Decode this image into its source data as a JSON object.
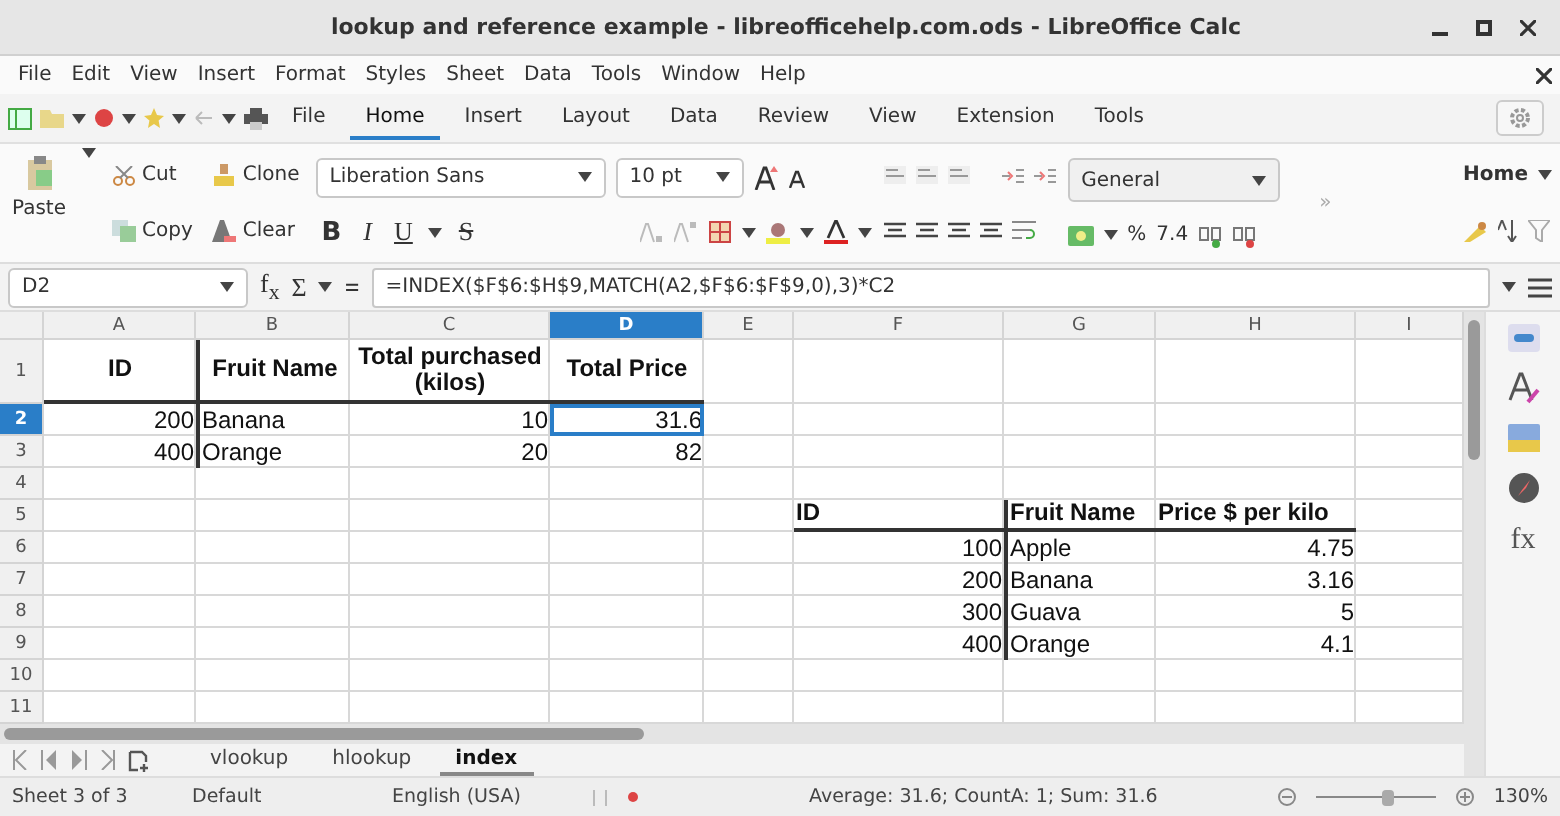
{
  "window": {
    "title": "lookup and reference example - libreofficehelp.com.ods - LibreOffice Calc"
  },
  "menu": [
    "File",
    "Edit",
    "View",
    "Insert",
    "Format",
    "Styles",
    "Sheet",
    "Data",
    "Tools",
    "Window",
    "Help"
  ],
  "tabs": [
    {
      "label": "File",
      "selected": false
    },
    {
      "label": "Home",
      "selected": true
    },
    {
      "label": "Insert",
      "selected": false
    },
    {
      "label": "Layout",
      "selected": false
    },
    {
      "label": "Data",
      "selected": false
    },
    {
      "label": "Review",
      "selected": false
    },
    {
      "label": "View",
      "selected": false
    },
    {
      "label": "Extension",
      "selected": false
    },
    {
      "label": "Tools",
      "selected": false
    }
  ],
  "ribbon": {
    "paste": "Paste",
    "cut": "Cut",
    "copy": "Copy",
    "clone": "Clone",
    "clear": "Clear",
    "font_name": "Liberation Sans",
    "font_size": "10 pt",
    "bold": "B",
    "italic": "I",
    "underline": "U",
    "strike": "S",
    "number_format": "General",
    "percent": "%",
    "decimal": "7.4",
    "more": "»",
    "style_menu": "Home"
  },
  "formula_bar": {
    "name_box": "D2",
    "function": "f$_{x}$",
    "sum": "Σ",
    "equals": "=",
    "formula": "=INDEX($F$6:$H$9,MATCH(A2,$F$6:$F$9,0),3)*C2"
  },
  "columns": [
    {
      "label": "A",
      "selected": false
    },
    {
      "label": "B",
      "selected": false
    },
    {
      "label": "C",
      "selected": false
    },
    {
      "label": "D",
      "selected": true
    },
    {
      "label": "E",
      "selected": false
    },
    {
      "label": "F",
      "selected": false
    },
    {
      "label": "G",
      "selected": false
    },
    {
      "label": "H",
      "selected": false
    },
    {
      "label": "I",
      "selected": false
    }
  ],
  "row_headers": [
    {
      "label": "1",
      "selected": false
    },
    {
      "label": "2",
      "selected": true
    },
    {
      "label": "3",
      "selected": false
    },
    {
      "label": "4",
      "selected": false
    },
    {
      "label": "5",
      "selected": false
    },
    {
      "label": "6",
      "selected": false
    },
    {
      "label": "7",
      "selected": false
    },
    {
      "label": "8",
      "selected": false
    },
    {
      "label": "9",
      "selected": false
    },
    {
      "label": "10",
      "selected": false
    },
    {
      "label": "11",
      "selected": false
    }
  ],
  "tables": [
    {
      "header": [
        "ID",
        "Fruit Name",
        "Total purchased (kilos)",
        "Total Price"
      ],
      "rows": [
        [
          {
            "text": "200",
            "selected": false
          },
          {
            "text": "Banana",
            "selected": false
          },
          {
            "text": "10",
            "selected": false
          },
          {
            "text": "31.6",
            "selected": true
          }
        ],
        [
          {
            "text": "400",
            "selected": false
          },
          {
            "text": "Orange",
            "selected": false
          },
          {
            "text": "20",
            "selected": false
          },
          {
            "text": "82",
            "selected": false
          }
        ]
      ]
    },
    {
      "header": [
        "ID",
        "Fruit Name",
        "Price $ per kilo"
      ],
      "rows": [
        [
          {
            "text": "100",
            "selected": false
          },
          {
            "text": "Apple",
            "selected": false
          },
          {
            "text": "4.75",
            "selected": false
          }
        ],
        [
          {
            "text": "200",
            "selected": false
          },
          {
            "text": "Banana",
            "selected": false
          },
          {
            "text": "3.16",
            "selected": false
          }
        ],
        [
          {
            "text": "300",
            "selected": false
          },
          {
            "text": "Guava",
            "selected": false
          },
          {
            "text": "5",
            "selected": false
          }
        ],
        [
          {
            "text": "400",
            "selected": false
          },
          {
            "text": "Orange",
            "selected": false
          },
          {
            "text": "4.1",
            "selected": false
          }
        ]
      ]
    }
  ],
  "sheet_tabs": [
    {
      "label": "vlookup",
      "selected": false
    },
    {
      "label": "hlookup",
      "selected": false
    },
    {
      "label": "index",
      "selected": true
    }
  ],
  "sidebar": {
    "functions": "fx"
  },
  "status_bar": {
    "sheet": "Sheet 3 of 3",
    "page_style": "Default",
    "language": "English (USA)",
    "summary": "Average: 31.6; CountA: 1; Sum: 31.6",
    "zoom_slider": {
      "level": 0.6
    },
    "zoom": "130%"
  }
}
